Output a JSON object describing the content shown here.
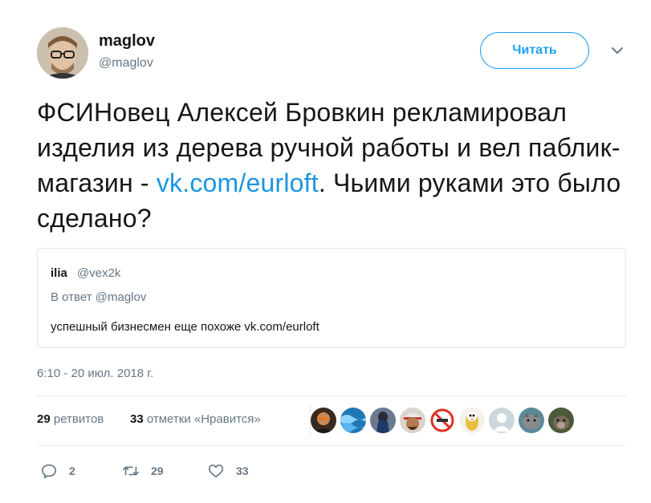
{
  "author": {
    "name": "maglov",
    "handle": "@maglov",
    "avatar_icon": "user-avatar-photo"
  },
  "follow_label": "Читать",
  "tweet": {
    "text_before": "ФСИНовец Алексей Бровкин рекламировал изделия из дерева ручной работы и вел паблик-магазин - ",
    "link": "vk.com/eurloft",
    "text_after": ". Чьими руками это было сделано?"
  },
  "quote": {
    "name": "ilia",
    "handle": "@vex2k",
    "reply_prefix": "В ответ",
    "reply_to": "@maglov",
    "text": "успешный бизнесмен еще похоже vk.com/eurloft"
  },
  "timestamp": "6:10 - 20 июл. 2018 г.",
  "stats": {
    "retweets_count": "29",
    "retweets_label": "ретвитов",
    "likes_count": "33",
    "likes_label": "отметки «Нравится»"
  },
  "liker_avatars": [
    "avatar-1",
    "avatar-2",
    "avatar-3",
    "avatar-4",
    "avatar-5",
    "avatar-6",
    "avatar-7",
    "avatar-8",
    "avatar-9"
  ],
  "actions": {
    "replies": "2",
    "retweets": "29",
    "likes": "33"
  },
  "colors": {
    "accent": "#1da1f2",
    "link": "#1b95e0",
    "muted": "#657786",
    "text": "#14171a",
    "border": "#e6ecf0"
  }
}
